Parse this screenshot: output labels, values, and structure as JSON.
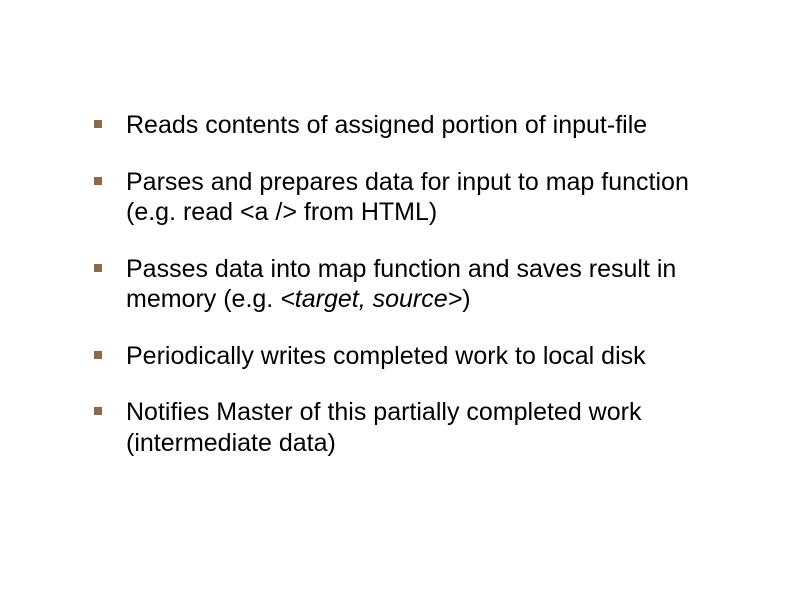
{
  "bullets": [
    {
      "text": "Reads contents of assigned portion of input-file"
    },
    {
      "text": "Parses and prepares data for input to map function (e.g. read <a /> from HTML)"
    },
    {
      "text_pre": "Passes data into map function and saves result in memory (e.g. ",
      "text_italic": "<target, source>",
      "text_post": ")"
    },
    {
      "text": "Periodically writes completed work to local disk"
    },
    {
      "text": "Notifies Master of this partially completed work (intermediate data)"
    }
  ]
}
